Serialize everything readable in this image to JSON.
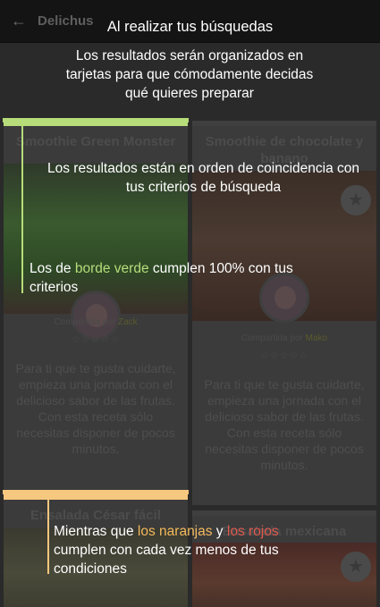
{
  "app": {
    "title": "Delichus"
  },
  "cards": [
    {
      "title": "Smoothie Green Monster",
      "shared_prefix": "Compartida por",
      "author": "Zack",
      "stars": "☆☆☆☆☆",
      "description": "Para ti que te gusta cuidarte, empieza una jornada con el delicioso sabor de las frutas. Con esta receta sólo necesitas disponer de pocos minutos.",
      "border_color": "#b7dc7a"
    },
    {
      "title": "Smoothie de chocolate y banano",
      "shared_prefix": "Compartida por",
      "author": "Mako",
      "stars": "☆☆☆☆☆",
      "description": "Para ti que te gusta cuidarte, empieza una jornada con el delicioso sabor de las frutas. Con esta receta sólo necesitas disponer de pocos minutos.",
      "border_color": "#3f3f3f"
    },
    {
      "title": "Ensalada César fácil",
      "border_color": "#f6c77e"
    },
    {
      "title": "Ensalada mexicana",
      "border_color": "#3f3f3f"
    }
  ],
  "tutorial": {
    "heading": "Al realizar tus búsquedas",
    "intro": "Los resultados serán organizados en tarjetas para que cómodamente decidas qué quieres preparar",
    "order": "Los resultados están en orden de coincidencia con tus criterios de búsqueda",
    "green_pre": "Los de ",
    "green_kw": "borde verde",
    "green_post": " cumplen 100% con tus criterios",
    "other_pre": "Mientras que ",
    "orange_kw": "los naranjas",
    "other_mid": " y ",
    "red_kw": "los rojos",
    "other_post": " cumplen con cada vez menos de tus condiciones"
  },
  "colors": {
    "green": "#b7dc7a",
    "orange": "#f6c77e",
    "red": "#e05a4d"
  }
}
